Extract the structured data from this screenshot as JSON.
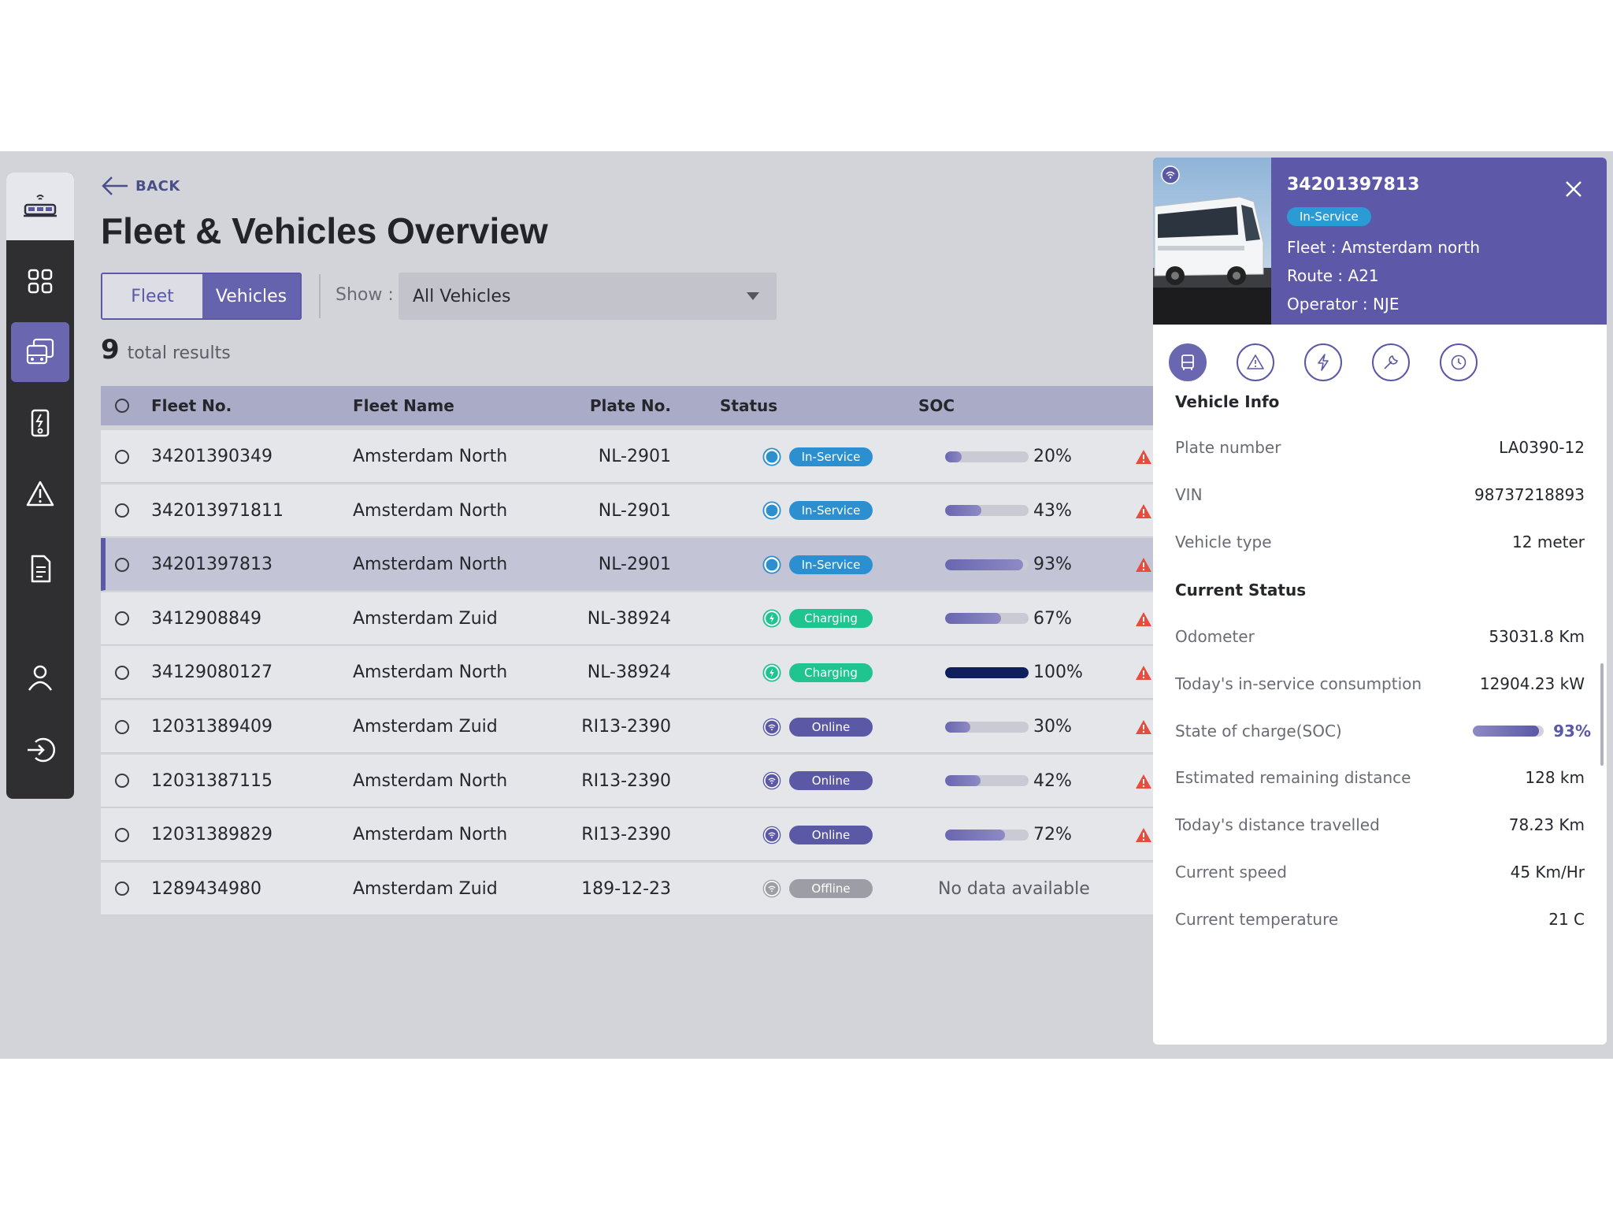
{
  "back_label": "BACK",
  "page_title": "Fleet & Vehicles Overview",
  "tabs": {
    "fleet": "Fleet",
    "vehicles": "Vehicles"
  },
  "filter": {
    "label": "Show :",
    "value": "All Vehicles"
  },
  "results": {
    "count": "9",
    "label": "total results"
  },
  "table": {
    "headers": {
      "fleet_no": "Fleet No.",
      "fleet_name": "Fleet Name",
      "plate_no": "Plate No.",
      "status": "Status",
      "soc": "SOC"
    },
    "rows": [
      {
        "fleet_no": "34201390349",
        "fleet_name": "Amsterdam North",
        "plate_no": "NL-2901",
        "status": "In-Service",
        "soc_text": "20%",
        "soc": 20
      },
      {
        "fleet_no": "342013971811",
        "fleet_name": "Amsterdam North",
        "plate_no": "NL-2901",
        "status": "In-Service",
        "soc_text": "43%",
        "soc": 43
      },
      {
        "fleet_no": "34201397813",
        "fleet_name": "Amsterdam North",
        "plate_no": "NL-2901",
        "status": "In-Service",
        "soc_text": "93%",
        "soc": 93
      },
      {
        "fleet_no": "3412908849",
        "fleet_name": "Amsterdam Zuid",
        "plate_no": "NL-38924",
        "status": "Charging",
        "soc_text": "67%",
        "soc": 67
      },
      {
        "fleet_no": "34129080127",
        "fleet_name": "Amsterdam North",
        "plate_no": "NL-38924",
        "status": "Charging",
        "soc_text": "100%",
        "soc": 100
      },
      {
        "fleet_no": "12031389409",
        "fleet_name": "Amsterdam Zuid",
        "plate_no": "RI13-2390",
        "status": "Online",
        "soc_text": "30%",
        "soc": 30
      },
      {
        "fleet_no": "12031387115",
        "fleet_name": "Amsterdam North",
        "plate_no": "RI13-2390",
        "status": "Online",
        "soc_text": "42%",
        "soc": 42
      },
      {
        "fleet_no": "12031389829",
        "fleet_name": "Amsterdam North",
        "plate_no": "RI13-2390",
        "status": "Online",
        "soc_text": "72%",
        "soc": 72
      },
      {
        "fleet_no": "1289434980",
        "fleet_name": "Amsterdam Zuid",
        "plate_no": "189-12-23",
        "status": "Offline",
        "soc_text": "No data available",
        "soc": null
      }
    ]
  },
  "status_colors": {
    "In-Service": "#2b8fd0",
    "Charging": "#1fc48f",
    "Online": "#5b58a6",
    "Offline": "#9c9da5"
  },
  "panel": {
    "id": "34201397813",
    "status": "In-Service",
    "fleet": "Fleet : Amsterdam north",
    "route": "Route : A21",
    "operator": "Operator : NJE",
    "tab_icons": [
      "bus-icon",
      "alert-icon",
      "bolt-icon",
      "wrench-icon",
      "clock-icon"
    ],
    "vehicle_info_title": "Vehicle Info",
    "vehicle_info": [
      {
        "k": "Plate number",
        "v": "LA0390-12"
      },
      {
        "k": "VIN",
        "v": "98737218893"
      },
      {
        "k": "Vehicle type",
        "v": "12 meter"
      }
    ],
    "current_status_title": "Current Status",
    "current_status": [
      {
        "k": "Odometer",
        "v": "53031.8 Km"
      },
      {
        "k": "Today's in-service consumption",
        "v": "12904.23 kW"
      },
      {
        "k": "State of charge(SOC)",
        "v": "93%",
        "soc": 93
      },
      {
        "k": "Estimated remaining distance",
        "v": "128 km"
      },
      {
        "k": "Today's distance travelled",
        "v": "78.23 Km"
      },
      {
        "k": "Current speed",
        "v": "45 Km/Hr"
      },
      {
        "k": "Current temperature",
        "v": "21 C"
      }
    ]
  }
}
